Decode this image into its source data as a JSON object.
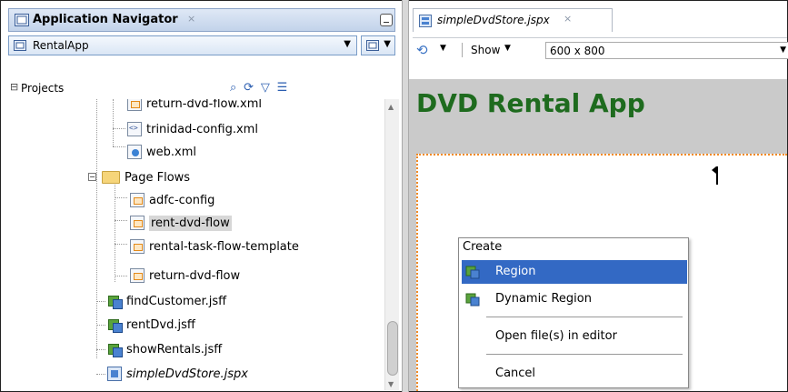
{
  "navigator": {
    "title": "Application Navigator",
    "close_glyph": "×",
    "app_selector": "RentalApp",
    "projects_label": "Projects",
    "tree": [
      {
        "label": "return-dvd-flow.xml",
        "icon": "task-flow-icon"
      },
      {
        "label": "trinidad-config.xml",
        "icon": "xml-file-icon"
      },
      {
        "label": "web.xml",
        "icon": "web-xml-icon"
      },
      {
        "label": "Page Flows",
        "icon": "folder-icon"
      },
      {
        "label": "adfc-config",
        "icon": "task-flow-icon"
      },
      {
        "label": "rent-dvd-flow",
        "icon": "task-flow-icon",
        "selected": true
      },
      {
        "label": "rental-task-flow-template",
        "icon": "task-flow-icon"
      },
      {
        "label": "return-dvd-flow",
        "icon": "task-flow-icon"
      },
      {
        "label": "findCustomer.jsff",
        "icon": "jsff-icon"
      },
      {
        "label": "rentDvd.jsff",
        "icon": "jsff-icon"
      },
      {
        "label": "showRentals.jsff",
        "icon": "jsff-icon"
      },
      {
        "label": "simpleDvdStore.jspx",
        "icon": "jspx-icon",
        "italic": true
      }
    ]
  },
  "editor": {
    "tab_label": "simpleDvdStore.jspx",
    "close_glyph": "×",
    "show_label": "Show",
    "size_value": "600 x 800",
    "page_title": "DVD Rental App"
  },
  "context_menu": {
    "header": "Create",
    "items": {
      "region": "Region",
      "dynamic_region": "Dynamic Region",
      "open_files": "Open file(s) in editor",
      "cancel": "Cancel"
    }
  },
  "colors": {
    "page_title": "#1e6b1e",
    "menu_highlight": "#3369c4",
    "dropzone_border": "#f08a24"
  }
}
